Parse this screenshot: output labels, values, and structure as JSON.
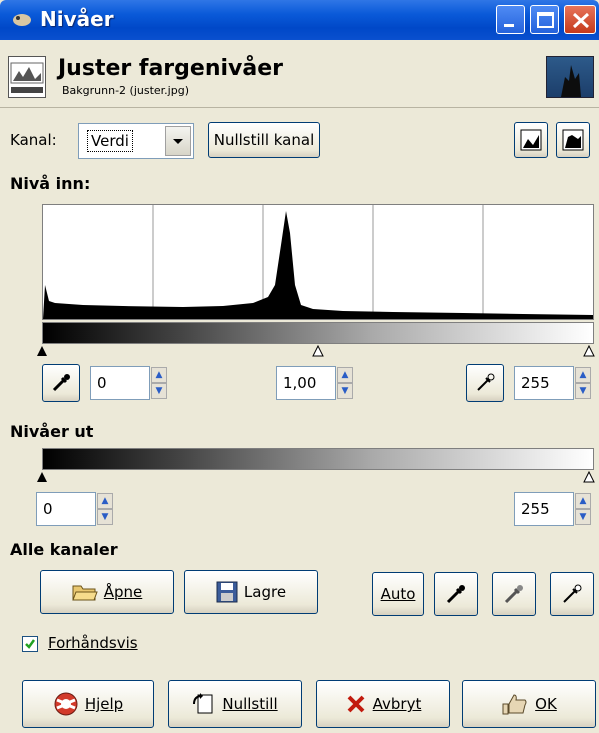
{
  "window": {
    "title": "Nivåer"
  },
  "header": {
    "title": "Juster fargenivåer",
    "subtitle": "Bakgrunn-2 (juster.jpg)"
  },
  "channel": {
    "label": "Kanal:",
    "value": "Verdi",
    "reset_label": "Nullstill kanal"
  },
  "input_levels": {
    "label": "Nivå inn:",
    "low": "0",
    "gamma": "1,00",
    "high": "255"
  },
  "output_levels": {
    "label": "Nivåer ut",
    "low": "0",
    "high": "255"
  },
  "all_channels": {
    "label": "Alle kanaler",
    "open_label": "Åpne",
    "save_label": "Lagre",
    "auto_label": "Auto"
  },
  "preview": {
    "label": "Forhåndsvis",
    "checked": true
  },
  "footer": {
    "help_label": "Hjelp",
    "reset_label": "Nullstill",
    "cancel_label": "Avbryt",
    "ok_label": "OK"
  }
}
